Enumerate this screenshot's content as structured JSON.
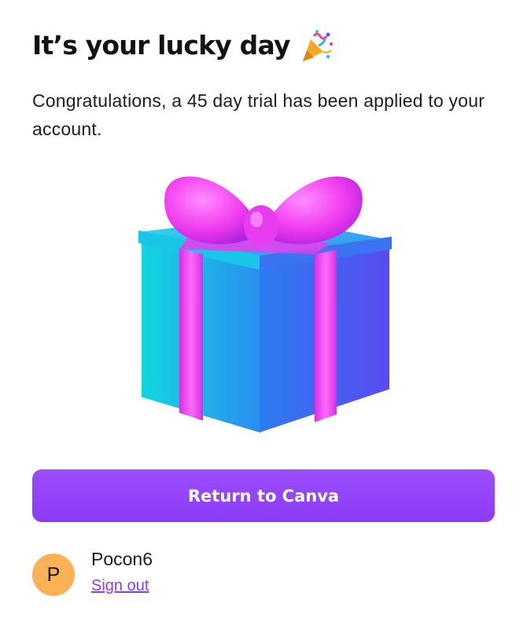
{
  "header": {
    "title": "It’s your lucky day",
    "title_icon": "party-popper-icon"
  },
  "main": {
    "message": "Congratulations, a 45 day trial has been applied to your account.",
    "illustration": "gift-box-icon",
    "cta_label": "Return to Canva"
  },
  "account": {
    "avatar_initial": "P",
    "username": "Pocon6",
    "signout_label": "Sign out"
  },
  "colors": {
    "accent": "#8b3df5",
    "button": "#9447f9",
    "avatar_bg": "#fbb155",
    "ribbon": "#f13bf1",
    "box_cyan": "#12c9e4",
    "box_blue": "#3c6ff0"
  }
}
